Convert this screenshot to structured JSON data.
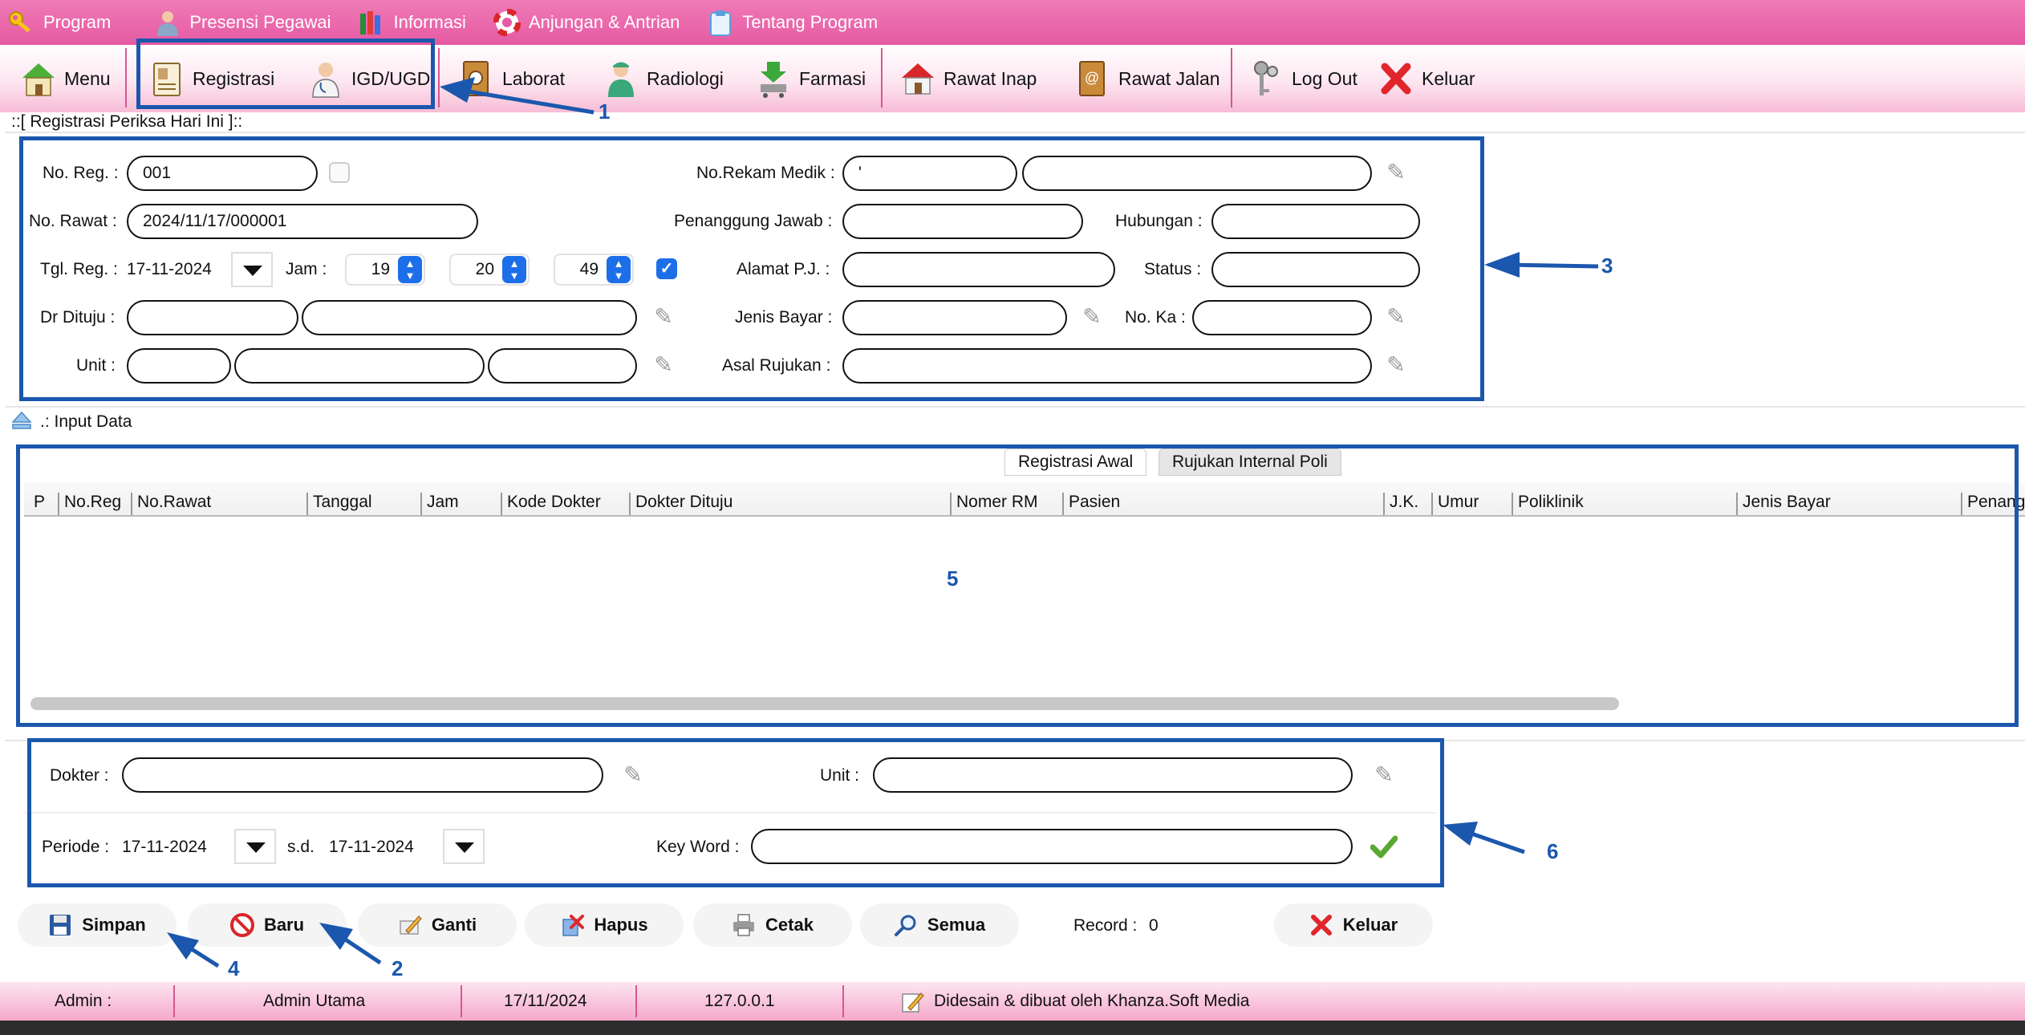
{
  "menubar": {
    "items": [
      {
        "label": "Program",
        "icon": "key-icon"
      },
      {
        "label": "Presensi Pegawai",
        "icon": "employee-icon"
      },
      {
        "label": "Informasi",
        "icon": "books-icon"
      },
      {
        "label": "Anjungan & Antrian",
        "icon": "lifebuoy-icon"
      },
      {
        "label": "Tentang Program",
        "icon": "clipboard-icon"
      }
    ]
  },
  "toolbar": {
    "menu": "Menu",
    "registrasi": "Registrasi",
    "igd": "IGD/UGD",
    "laborat": "Laborat",
    "radiologi": "Radiologi",
    "farmasi": "Farmasi",
    "rawat_inap": "Rawat Inap",
    "rawat_jalan": "Rawat Jalan",
    "logout": "Log Out",
    "keluar": "Keluar"
  },
  "form": {
    "title": "::[ Registrasi Periksa Hari Ini ]::",
    "no_reg_label": "No. Reg. :",
    "no_reg_value": "001",
    "no_rawat_label": "No. Rawat :",
    "no_rawat_value": "2024/11/17/000001",
    "tgl_reg_label": "Tgl. Reg. :",
    "tgl_reg_value": "17-11-2024",
    "jam_label": "Jam :",
    "jam_hour": "19",
    "jam_minute": "20",
    "jam_second": "49",
    "dr_dituju_label": "Dr Dituju :",
    "unit_label": "Unit :",
    "no_rekam_medik_label": "No.Rekam Medik :",
    "no_rekam_medik_value": "'",
    "penanggung_jawab_label": "Penanggung Jawab :",
    "hubungan_label": "Hubungan :",
    "alamat_pj_label": "Alamat P.J. :",
    "status_label": "Status :",
    "jenis_bayar_label": "Jenis Bayar :",
    "no_ka_label": "No. Ka :",
    "asal_rujukan_label": "Asal Rujukan :"
  },
  "input_section": {
    "title": ".: Input Data"
  },
  "table": {
    "tabs": [
      "Registrasi Awal",
      "Rujukan Internal Poli"
    ],
    "columns": [
      "P",
      "No.Reg",
      "No.Rawat",
      "Tanggal",
      "Jam",
      "Kode Dokter",
      "Dokter Dituju",
      "Nomer RM",
      "Pasien",
      "J.K.",
      "Umur",
      "Poliklinik",
      "Jenis Bayar",
      "Penang"
    ]
  },
  "filter": {
    "dokter_label": "Dokter :",
    "unit_label": "Unit :",
    "periode_label": "Periode :",
    "periode_from": "17-11-2024",
    "sd_label": "s.d.",
    "periode_to": "17-11-2024",
    "keyword_label": "Key Word :"
  },
  "buttons": {
    "simpan": "Simpan",
    "baru": "Baru",
    "ganti": "Ganti",
    "hapus": "Hapus",
    "cetak": "Cetak",
    "semua": "Semua",
    "record_label": "Record :",
    "record_value": "0",
    "keluar": "Keluar"
  },
  "statusbar": {
    "user_label": "Admin :",
    "user_name": "Admin Utama",
    "date": "17/11/2024",
    "ip": "127.0.0.1",
    "credit": "Didesain & dibuat oleh Khanza.Soft Media"
  },
  "annotations": [
    "1",
    "2",
    "3",
    "4",
    "5",
    "6"
  ],
  "colors": {
    "menubar_pink": "#e55aa2",
    "annotation_blue": "#1b57ad",
    "spinner_blue": "#1c6fe8",
    "ok_green": "#5aa832",
    "close_red": "#e0262b"
  }
}
